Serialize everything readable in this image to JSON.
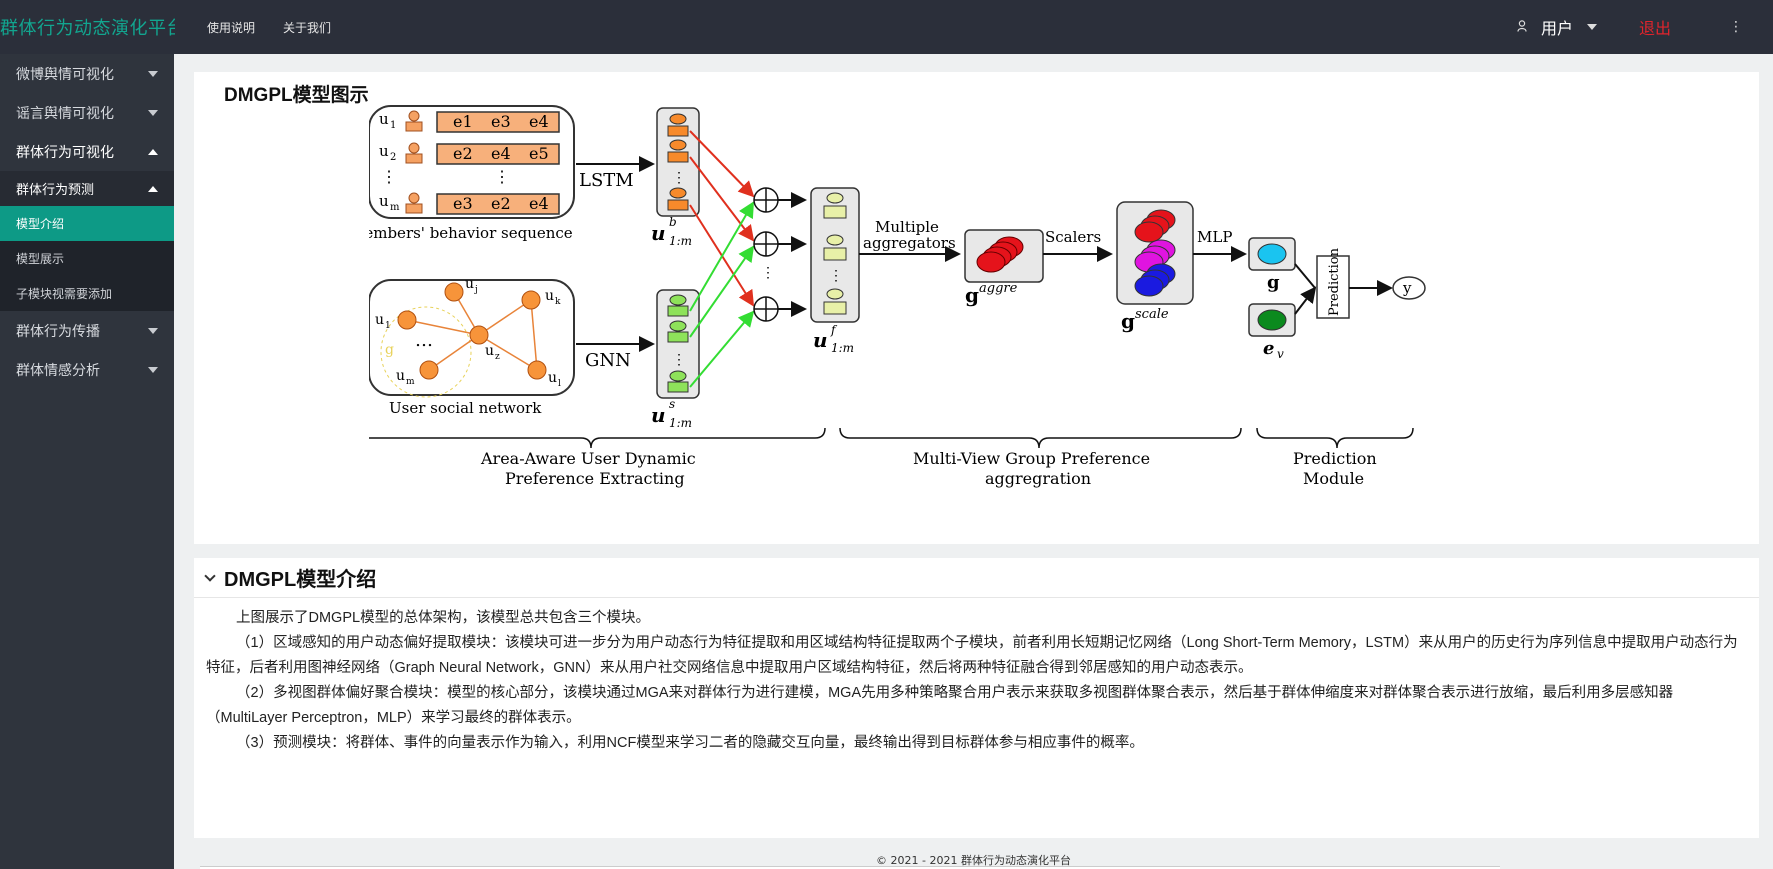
{
  "header": {
    "brand": "群体行为动态演化平台",
    "nav": [
      "使用说明",
      "关于我们"
    ],
    "user": "用户",
    "logout": "退出",
    "more": "⋮"
  },
  "sidebar": {
    "items": [
      {
        "label": "微博舆情可视化"
      },
      {
        "label": "谣言舆情可视化"
      },
      {
        "label": "群体行为可视化"
      }
    ],
    "sub": {
      "label": "群体行为预测"
    },
    "leaves": [
      {
        "label": "模型介绍"
      },
      {
        "label": "模型展示"
      },
      {
        "label": "子模块视需要添加"
      }
    ],
    "items_after": [
      {
        "label": "群体行为传播"
      },
      {
        "label": "群体情感分析"
      }
    ]
  },
  "panel1": {
    "title": "DMGPL模型图示"
  },
  "diagram": {
    "members_label": "Members' behavior sequence",
    "social_label": "User social network",
    "lstm": "LSTM",
    "gnn": "GNN",
    "multiple": "Multiple",
    "aggregators": "aggregators",
    "scalers": "Scalers",
    "mlp": "MLP",
    "prediction": "Prediction",
    "y": "y",
    "u1": "u",
    "g_label": "g",
    "ev_label": "e",
    "section1_a": "Area-Aware User Dynamic",
    "section1_b": "Preference Extracting",
    "section2_a": "Multi-View Group Preference",
    "section2_b": "aggregration",
    "section3_a": "Prediction",
    "section3_b": "Module",
    "seq_rows": [
      [
        "e1",
        "e3",
        "e4"
      ],
      [
        "e2",
        "e4",
        "e5"
      ],
      [
        "e3",
        "e2",
        "e4"
      ]
    ]
  },
  "panel2": {
    "title": "DMGPL模型介绍",
    "paragraphs": [
      "上图展示了DMGPL模型的总体架构，该模型总共包含三个模块。",
      "（1）区域感知的用户动态偏好提取模块：该模块可进一步分为用户动态行为特征提取和用区域结构特征提取两个子模块，前者利用长短期记忆网络（Long Short-Term Memory，LSTM）来从用户的历史行为序列信息中提取用户动态行为特征，后者利用图神经网络（Graph Neural Network，GNN）来从用户社交网络信息中提取用户区域结构特征，然后将两种特征融合得到邻居感知的用户动态表示。",
      "（2）多视图群体偏好聚合模块：模型的核心部分，该模块通过MGA来对群体行为进行建模，MGA先用多种策略聚合用户表示来获取多视图群体聚合表示，然后基于群体伸缩度来对群体聚合表示进行放缩，最后利用多层感知器（MultiLayer Perceptron，MLP）来学习最终的群体表示。",
      "（3）预测模块：将群体、事件的向量表示作为输入，利用NCF模型来学习二者的隐藏交互向量，最终输出得到目标群体参与相应事件的概率。"
    ]
  },
  "footer": {
    "text": "© 2021 - 2021 群体行为动态演化平台"
  }
}
